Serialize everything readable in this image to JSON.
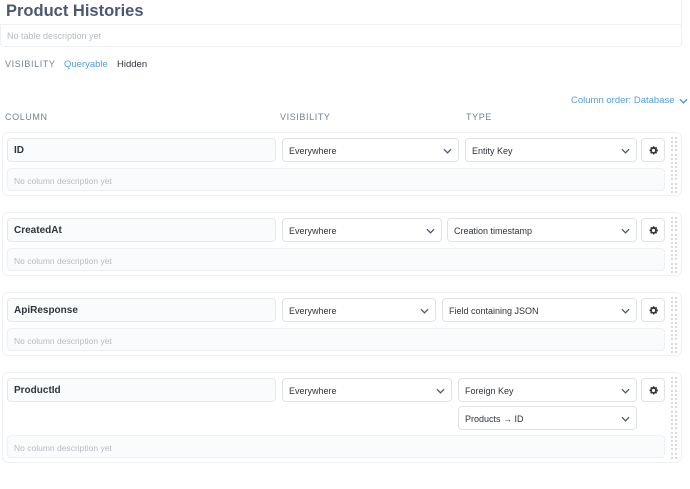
{
  "table": {
    "title": "Product Histories",
    "description_placeholder": "No table description yet"
  },
  "visibility": {
    "label": "VISIBILITY",
    "options": [
      "Queryable",
      "Hidden"
    ],
    "selected": "Queryable"
  },
  "column_order": {
    "label": "Column order: Database"
  },
  "headers": {
    "column": "COLUMN",
    "visibility": "VISIBILITY",
    "type": "TYPE"
  },
  "columns": [
    {
      "name": "ID",
      "visibility": "Everywhere",
      "type": "Entity Key",
      "description_placeholder": "No column description yet"
    },
    {
      "name": "CreatedAt",
      "visibility": "Everywhere",
      "type": "Creation timestamp",
      "description_placeholder": "No column description yet"
    },
    {
      "name": "ApiResponse",
      "visibility": "Everywhere",
      "type": "Field containing JSON",
      "description_placeholder": "No column description yet"
    },
    {
      "name": "ProductId",
      "visibility": "Everywhere",
      "type": "Foreign Key",
      "target": "Products → ID",
      "description_placeholder": "No column description yet"
    }
  ],
  "colors": {
    "accent": "#509ee3",
    "title": "#4c5773",
    "muted": "#74838f",
    "placeholder": "#b7bcc2",
    "border": "#eef0f2"
  },
  "icons": {
    "chevron": "chevron-down-icon",
    "settings": "gear-icon",
    "drag": "grip-icon"
  }
}
